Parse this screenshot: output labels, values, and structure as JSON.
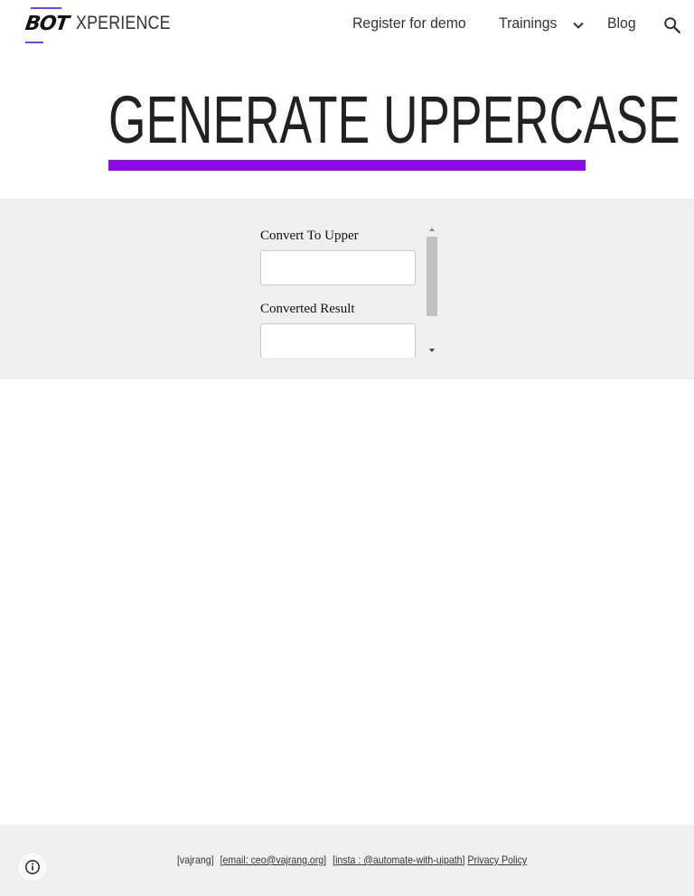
{
  "header": {
    "logo_text": "BOT",
    "site_title": "XPERIENCE",
    "nav": {
      "demo": "Register for demo",
      "trainings": "Trainings",
      "blog": "Blog"
    },
    "icons": [
      "chevron-down-icon",
      "search-icon"
    ]
  },
  "hero": {
    "title": "GENERATE UPPERCASE",
    "underline_color": "#8c0aeb"
  },
  "embed": {
    "input_label": "Convert To Upper",
    "input_value": "",
    "result_label": "Converted Result",
    "result_value": ""
  },
  "footer": {
    "name": "[vajrang]",
    "email": "[email: ceo@vajrang.org]",
    "insta_open": "[",
    "insta": "insta : @automate-with-uipath",
    "insta_close": "]",
    "privacy": "Privacy Policy",
    "info_icon": "info-icon"
  },
  "colors": {
    "accent": "#8c0aeb",
    "band_bg": "#efefef",
    "footer_bg": "#f0f0f0"
  }
}
